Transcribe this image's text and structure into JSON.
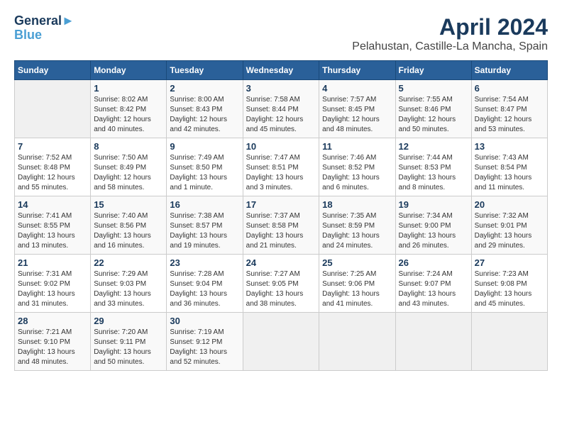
{
  "logo": {
    "line1": "General",
    "line2": "Blue"
  },
  "title": "April 2024",
  "subtitle": "Pelahustan, Castille-La Mancha, Spain",
  "weekdays": [
    "Sunday",
    "Monday",
    "Tuesday",
    "Wednesday",
    "Thursday",
    "Friday",
    "Saturday"
  ],
  "weeks": [
    [
      {
        "day": "",
        "info": ""
      },
      {
        "day": "1",
        "info": "Sunrise: 8:02 AM\nSunset: 8:42 PM\nDaylight: 12 hours\nand 40 minutes."
      },
      {
        "day": "2",
        "info": "Sunrise: 8:00 AM\nSunset: 8:43 PM\nDaylight: 12 hours\nand 42 minutes."
      },
      {
        "day": "3",
        "info": "Sunrise: 7:58 AM\nSunset: 8:44 PM\nDaylight: 12 hours\nand 45 minutes."
      },
      {
        "day": "4",
        "info": "Sunrise: 7:57 AM\nSunset: 8:45 PM\nDaylight: 12 hours\nand 48 minutes."
      },
      {
        "day": "5",
        "info": "Sunrise: 7:55 AM\nSunset: 8:46 PM\nDaylight: 12 hours\nand 50 minutes."
      },
      {
        "day": "6",
        "info": "Sunrise: 7:54 AM\nSunset: 8:47 PM\nDaylight: 12 hours\nand 53 minutes."
      }
    ],
    [
      {
        "day": "7",
        "info": "Sunrise: 7:52 AM\nSunset: 8:48 PM\nDaylight: 12 hours\nand 55 minutes."
      },
      {
        "day": "8",
        "info": "Sunrise: 7:50 AM\nSunset: 8:49 PM\nDaylight: 12 hours\nand 58 minutes."
      },
      {
        "day": "9",
        "info": "Sunrise: 7:49 AM\nSunset: 8:50 PM\nDaylight: 13 hours\nand 1 minute."
      },
      {
        "day": "10",
        "info": "Sunrise: 7:47 AM\nSunset: 8:51 PM\nDaylight: 13 hours\nand 3 minutes."
      },
      {
        "day": "11",
        "info": "Sunrise: 7:46 AM\nSunset: 8:52 PM\nDaylight: 13 hours\nand 6 minutes."
      },
      {
        "day": "12",
        "info": "Sunrise: 7:44 AM\nSunset: 8:53 PM\nDaylight: 13 hours\nand 8 minutes."
      },
      {
        "day": "13",
        "info": "Sunrise: 7:43 AM\nSunset: 8:54 PM\nDaylight: 13 hours\nand 11 minutes."
      }
    ],
    [
      {
        "day": "14",
        "info": "Sunrise: 7:41 AM\nSunset: 8:55 PM\nDaylight: 13 hours\nand 13 minutes."
      },
      {
        "day": "15",
        "info": "Sunrise: 7:40 AM\nSunset: 8:56 PM\nDaylight: 13 hours\nand 16 minutes."
      },
      {
        "day": "16",
        "info": "Sunrise: 7:38 AM\nSunset: 8:57 PM\nDaylight: 13 hours\nand 19 minutes."
      },
      {
        "day": "17",
        "info": "Sunrise: 7:37 AM\nSunset: 8:58 PM\nDaylight: 13 hours\nand 21 minutes."
      },
      {
        "day": "18",
        "info": "Sunrise: 7:35 AM\nSunset: 8:59 PM\nDaylight: 13 hours\nand 24 minutes."
      },
      {
        "day": "19",
        "info": "Sunrise: 7:34 AM\nSunset: 9:00 PM\nDaylight: 13 hours\nand 26 minutes."
      },
      {
        "day": "20",
        "info": "Sunrise: 7:32 AM\nSunset: 9:01 PM\nDaylight: 13 hours\nand 29 minutes."
      }
    ],
    [
      {
        "day": "21",
        "info": "Sunrise: 7:31 AM\nSunset: 9:02 PM\nDaylight: 13 hours\nand 31 minutes."
      },
      {
        "day": "22",
        "info": "Sunrise: 7:29 AM\nSunset: 9:03 PM\nDaylight: 13 hours\nand 33 minutes."
      },
      {
        "day": "23",
        "info": "Sunrise: 7:28 AM\nSunset: 9:04 PM\nDaylight: 13 hours\nand 36 minutes."
      },
      {
        "day": "24",
        "info": "Sunrise: 7:27 AM\nSunset: 9:05 PM\nDaylight: 13 hours\nand 38 minutes."
      },
      {
        "day": "25",
        "info": "Sunrise: 7:25 AM\nSunset: 9:06 PM\nDaylight: 13 hours\nand 41 minutes."
      },
      {
        "day": "26",
        "info": "Sunrise: 7:24 AM\nSunset: 9:07 PM\nDaylight: 13 hours\nand 43 minutes."
      },
      {
        "day": "27",
        "info": "Sunrise: 7:23 AM\nSunset: 9:08 PM\nDaylight: 13 hours\nand 45 minutes."
      }
    ],
    [
      {
        "day": "28",
        "info": "Sunrise: 7:21 AM\nSunset: 9:10 PM\nDaylight: 13 hours\nand 48 minutes."
      },
      {
        "day": "29",
        "info": "Sunrise: 7:20 AM\nSunset: 9:11 PM\nDaylight: 13 hours\nand 50 minutes."
      },
      {
        "day": "30",
        "info": "Sunrise: 7:19 AM\nSunset: 9:12 PM\nDaylight: 13 hours\nand 52 minutes."
      },
      {
        "day": "",
        "info": ""
      },
      {
        "day": "",
        "info": ""
      },
      {
        "day": "",
        "info": ""
      },
      {
        "day": "",
        "info": ""
      }
    ]
  ]
}
